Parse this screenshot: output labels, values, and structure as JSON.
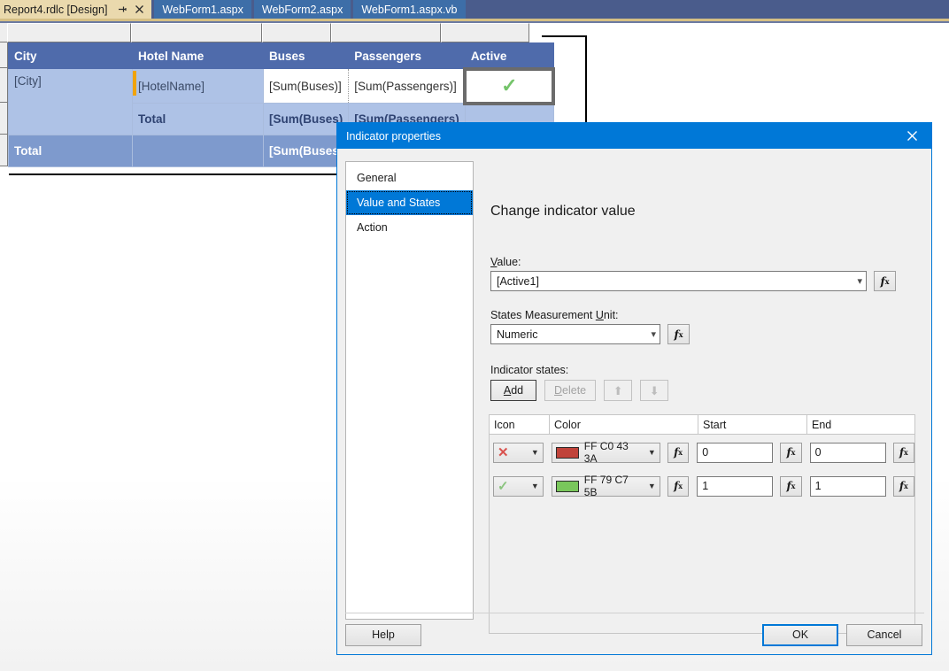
{
  "tabs": [
    {
      "label": "Report4.rdlc [Design]",
      "active": true,
      "pin_icon": "pin-icon",
      "close_icon": "close-icon"
    },
    {
      "label": "WebForm1.aspx",
      "active": false
    },
    {
      "label": "WebForm2.aspx",
      "active": false
    },
    {
      "label": "WebForm1.aspx.vb",
      "active": false
    }
  ],
  "report": {
    "columns": [
      "City",
      "Hotel Name",
      "Buses",
      "Passengers",
      "Active"
    ],
    "rows": [
      {
        "type": "detail",
        "cells": [
          "[City]",
          "[HotelName]",
          "[Sum(Buses)]",
          "[Sum(Passengers)]",
          ""
        ],
        "indicator_icon": "check-icon"
      },
      {
        "type": "group-total",
        "cells": [
          "",
          "Total",
          "[Sum(Buses)",
          "[Sum(Passengers)",
          ""
        ]
      },
      {
        "type": "grand-total",
        "cells": [
          "Total",
          "",
          "[Sum(Buses)",
          "",
          ""
        ]
      }
    ]
  },
  "dialog": {
    "title": "Indicator properties",
    "close_label": "✕",
    "nav": [
      {
        "label": "General",
        "selected": false
      },
      {
        "label": "Value and States",
        "selected": true
      },
      {
        "label": "Action",
        "selected": false
      }
    ],
    "heading": "Change indicator value",
    "value_label": "Value:",
    "value_label_pre": "V",
    "value_label_post": "alue:",
    "value": "[Active1]",
    "unit_label_pre": "States Measurement ",
    "unit_label_mid": "U",
    "unit_label_post": "nit:",
    "unit_value": "Numeric",
    "fx_label": "fx",
    "states_label": "Indicator states:",
    "toolbar": {
      "add": "Add",
      "add_pre": "A",
      "add_post": "dd",
      "delete": "Delete",
      "delete_pre": "D",
      "delete_post": "elete",
      "move_up_icon": "arrow-up-icon",
      "move_down_icon": "arrow-down-icon"
    },
    "grid": {
      "headers": [
        "Icon",
        "Color",
        "Start",
        "End"
      ],
      "rows": [
        {
          "icon": "✕",
          "icon_name": "cross-icon",
          "icon_color": "#d9534f",
          "color_hex": "#C0433A",
          "color_text": "FF C0 43 3A",
          "start": "0",
          "end": "0"
        },
        {
          "icon": "✓",
          "icon_name": "check-icon",
          "icon_color": "#8bc47f",
          "color_hex": "#79C75B",
          "color_text": "FF 79 C7 5B",
          "start": "1",
          "end": "1"
        }
      ]
    },
    "buttons": {
      "help": "Help",
      "ok": "OK",
      "cancel": "Cancel"
    }
  },
  "colors": {
    "accent": "#0078d7",
    "header_row": "#4f6bab",
    "detail_row": "#aec2e6",
    "grand_total_row": "#7e9acd",
    "active_tab": "#ead9ad"
  }
}
